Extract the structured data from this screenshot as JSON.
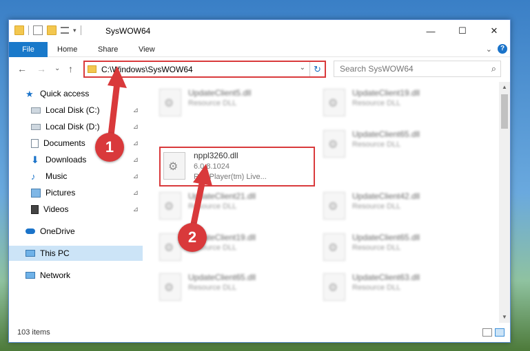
{
  "window": {
    "title": "SysWOW64",
    "controls": {
      "minimize": "—",
      "maximize": "☐",
      "close": "✕"
    }
  },
  "ribbon": {
    "tabs": [
      "File",
      "Home",
      "Share",
      "View"
    ],
    "expand": "⌄",
    "help": "?"
  },
  "nav": {
    "back": "←",
    "forward": "→",
    "recent": "⌄",
    "up": "↑"
  },
  "address": {
    "path": "C:\\Windows\\SysWOW64",
    "dropdown": "⌄",
    "refresh": "↻"
  },
  "search": {
    "placeholder": "Search SysWOW64",
    "icon": "search-icon"
  },
  "sidebar": {
    "items": [
      {
        "label": "Quick access",
        "icon": "star-icon",
        "pinned": false
      },
      {
        "label": "Local Disk (C:)",
        "icon": "drive-icon",
        "pinned": true
      },
      {
        "label": "Local Disk (D:)",
        "icon": "drive-icon",
        "pinned": true
      },
      {
        "label": "Documents",
        "icon": "documents-icon",
        "pinned": true
      },
      {
        "label": "Downloads",
        "icon": "downloads-icon",
        "pinned": true
      },
      {
        "label": "Music",
        "icon": "music-icon",
        "pinned": true
      },
      {
        "label": "Pictures",
        "icon": "pictures-icon",
        "pinned": true
      },
      {
        "label": "Videos",
        "icon": "videos-icon",
        "pinned": true
      },
      {
        "label": "OneDrive",
        "icon": "cloud-icon",
        "pinned": false
      },
      {
        "label": "This PC",
        "icon": "computer-icon",
        "pinned": false,
        "selected": true
      },
      {
        "label": "Network",
        "icon": "network-icon",
        "pinned": false
      }
    ],
    "pin_glyph": "📌"
  },
  "files": [
    {
      "name": "UpdateClient5.dll",
      "type": "Resource DLL",
      "blurred": true
    },
    {
      "name": "UpdateClient19.dll",
      "type": "Resource DLL",
      "blurred": true
    },
    {
      "name": "nppl3260.dll",
      "version": "6.0.8.1024",
      "description": "RealPlayer(tm) Live...",
      "blurred": false,
      "highlighted": true
    },
    {
      "name": "UpdateClient65.dll",
      "type": "Resource DLL",
      "blurred": true
    },
    {
      "name": "UpdateClient21.dll",
      "type": "Resource DLL",
      "blurred": true
    },
    {
      "name": "UpdateClient42.dll",
      "type": "Resource DLL",
      "blurred": true
    },
    {
      "name": "UpdateClient19.dll",
      "type": "Resource DLL",
      "blurred": true
    },
    {
      "name": "UpdateClient65.dll",
      "type": "Resource DLL",
      "blurred": true
    },
    {
      "name": "UpdateClient65.dll",
      "type": "Resource DLL",
      "blurred": true
    },
    {
      "name": "UpdateClient63.dll",
      "type": "Resource DLL",
      "blurred": true
    }
  ],
  "status": {
    "item_count": "103 items"
  },
  "annotations": {
    "step1": "1",
    "step2": "2",
    "color": "#d9393b"
  }
}
